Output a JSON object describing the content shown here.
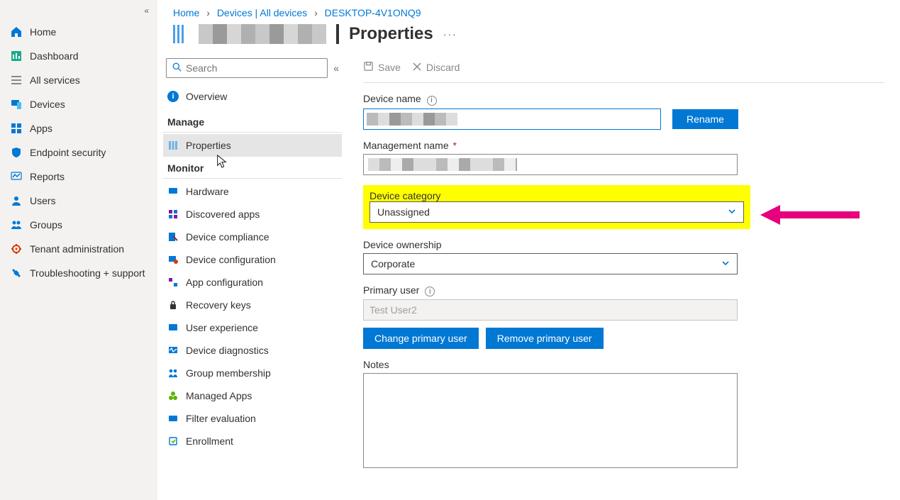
{
  "breadcrumb": {
    "home": "Home",
    "devices": "Devices | All devices",
    "device": "DESKTOP-4V1ONQ9"
  },
  "page_title": "Properties",
  "leftnav": {
    "items": [
      {
        "label": "Home",
        "icon": "home-icon"
      },
      {
        "label": "Dashboard",
        "icon": "dashboard-icon"
      },
      {
        "label": "All services",
        "icon": "all-services-icon"
      },
      {
        "label": "Devices",
        "icon": "devices-icon"
      },
      {
        "label": "Apps",
        "icon": "apps-icon"
      },
      {
        "label": "Endpoint security",
        "icon": "endpoint-security-icon"
      },
      {
        "label": "Reports",
        "icon": "reports-icon"
      },
      {
        "label": "Users",
        "icon": "users-icon"
      },
      {
        "label": "Groups",
        "icon": "groups-icon"
      },
      {
        "label": "Tenant administration",
        "icon": "tenant-admin-icon"
      },
      {
        "label": "Troubleshooting + support",
        "icon": "troubleshoot-icon"
      }
    ]
  },
  "midcol": {
    "search_placeholder": "Search",
    "overview": "Overview",
    "section_manage": "Manage",
    "section_monitor": "Monitor",
    "manage_items": [
      {
        "label": "Properties"
      }
    ],
    "monitor_items": [
      {
        "label": "Hardware"
      },
      {
        "label": "Discovered apps"
      },
      {
        "label": "Device compliance"
      },
      {
        "label": "Device configuration"
      },
      {
        "label": "App configuration"
      },
      {
        "label": "Recovery keys"
      },
      {
        "label": "User experience"
      },
      {
        "label": "Device diagnostics"
      },
      {
        "label": "Group membership"
      },
      {
        "label": "Managed Apps"
      },
      {
        "label": "Filter evaluation"
      },
      {
        "label": "Enrollment"
      }
    ]
  },
  "toolbar": {
    "save": "Save",
    "discard": "Discard"
  },
  "form": {
    "device_name_label": "Device name",
    "rename_btn": "Rename",
    "management_name_label": "Management name",
    "device_category_label": "Device category",
    "device_category_value": "Unassigned",
    "device_ownership_label": "Device ownership",
    "device_ownership_value": "Corporate",
    "primary_user_label": "Primary user",
    "primary_user_value": "Test User2",
    "change_primary_btn": "Change primary user",
    "remove_primary_btn": "Remove primary user",
    "notes_label": "Notes",
    "notes_value": ""
  },
  "colors": {
    "accent": "#0078d4",
    "highlight": "#ffff00",
    "arrow": "#e6007e"
  }
}
